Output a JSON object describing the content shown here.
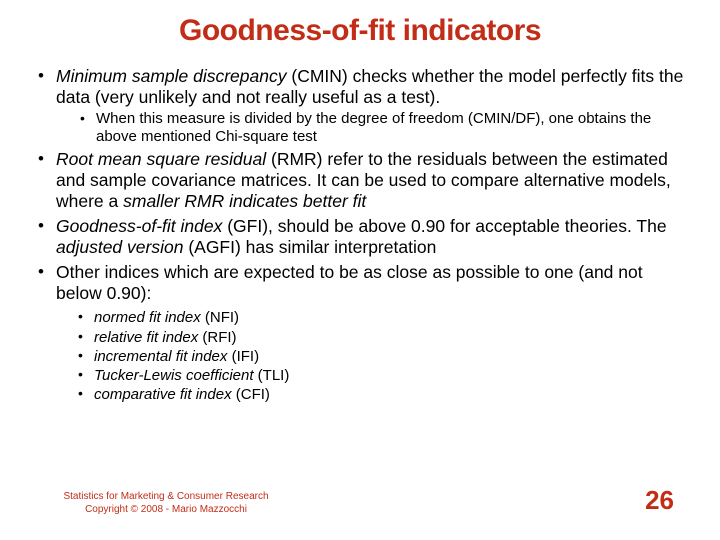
{
  "title": "Goodness-of-fit indicators",
  "bullets": {
    "b1_pre": "Minimum sample discrepancy",
    "b1_rest": " (CMIN) checks whether the model perfectly fits the data (very unlikely and not really useful as a test).",
    "b1_sub": "When this measure is divided by the degree of freedom (CMIN/DF), one obtains the above mentioned Chi-square test",
    "b2_pre": "Root mean square residual",
    "b2_mid": " (RMR) refer to the residuals between the estimated and sample covariance matrices. It can be used to compare alternative models, where a ",
    "b2_em": "smaller RMR indicates better fit",
    "b3_pre": "Goodness-of-fit index",
    "b3_mid": " (GFI), should be above 0.90 for acceptable theories. The ",
    "b3_em": "adjusted version",
    "b3_rest": "  (AGFI) has similar interpretation",
    "b4": "Other indices which are expected to be as close as possible to one (and not below 0.90):",
    "sub": {
      "s1_pre": "normed fit index",
      "s1_rest": " (NFI)",
      "s2_pre": "relative fit index",
      "s2_rest": " (RFI)",
      "s3_pre": "incremental fit index",
      "s3_rest": " (IFI)",
      "s4_pre": "Tucker-Lewis coefficient",
      "s4_rest": " (TLI)",
      "s5_pre": "comparative fit index",
      "s5_rest": " (CFI)"
    }
  },
  "footer": {
    "line1": "Statistics for Marketing & Consumer Research",
    "line2": "Copyright © 2008 - Mario Mazzocchi"
  },
  "page_number": "26",
  "colors": {
    "accent": "#c22d17"
  }
}
